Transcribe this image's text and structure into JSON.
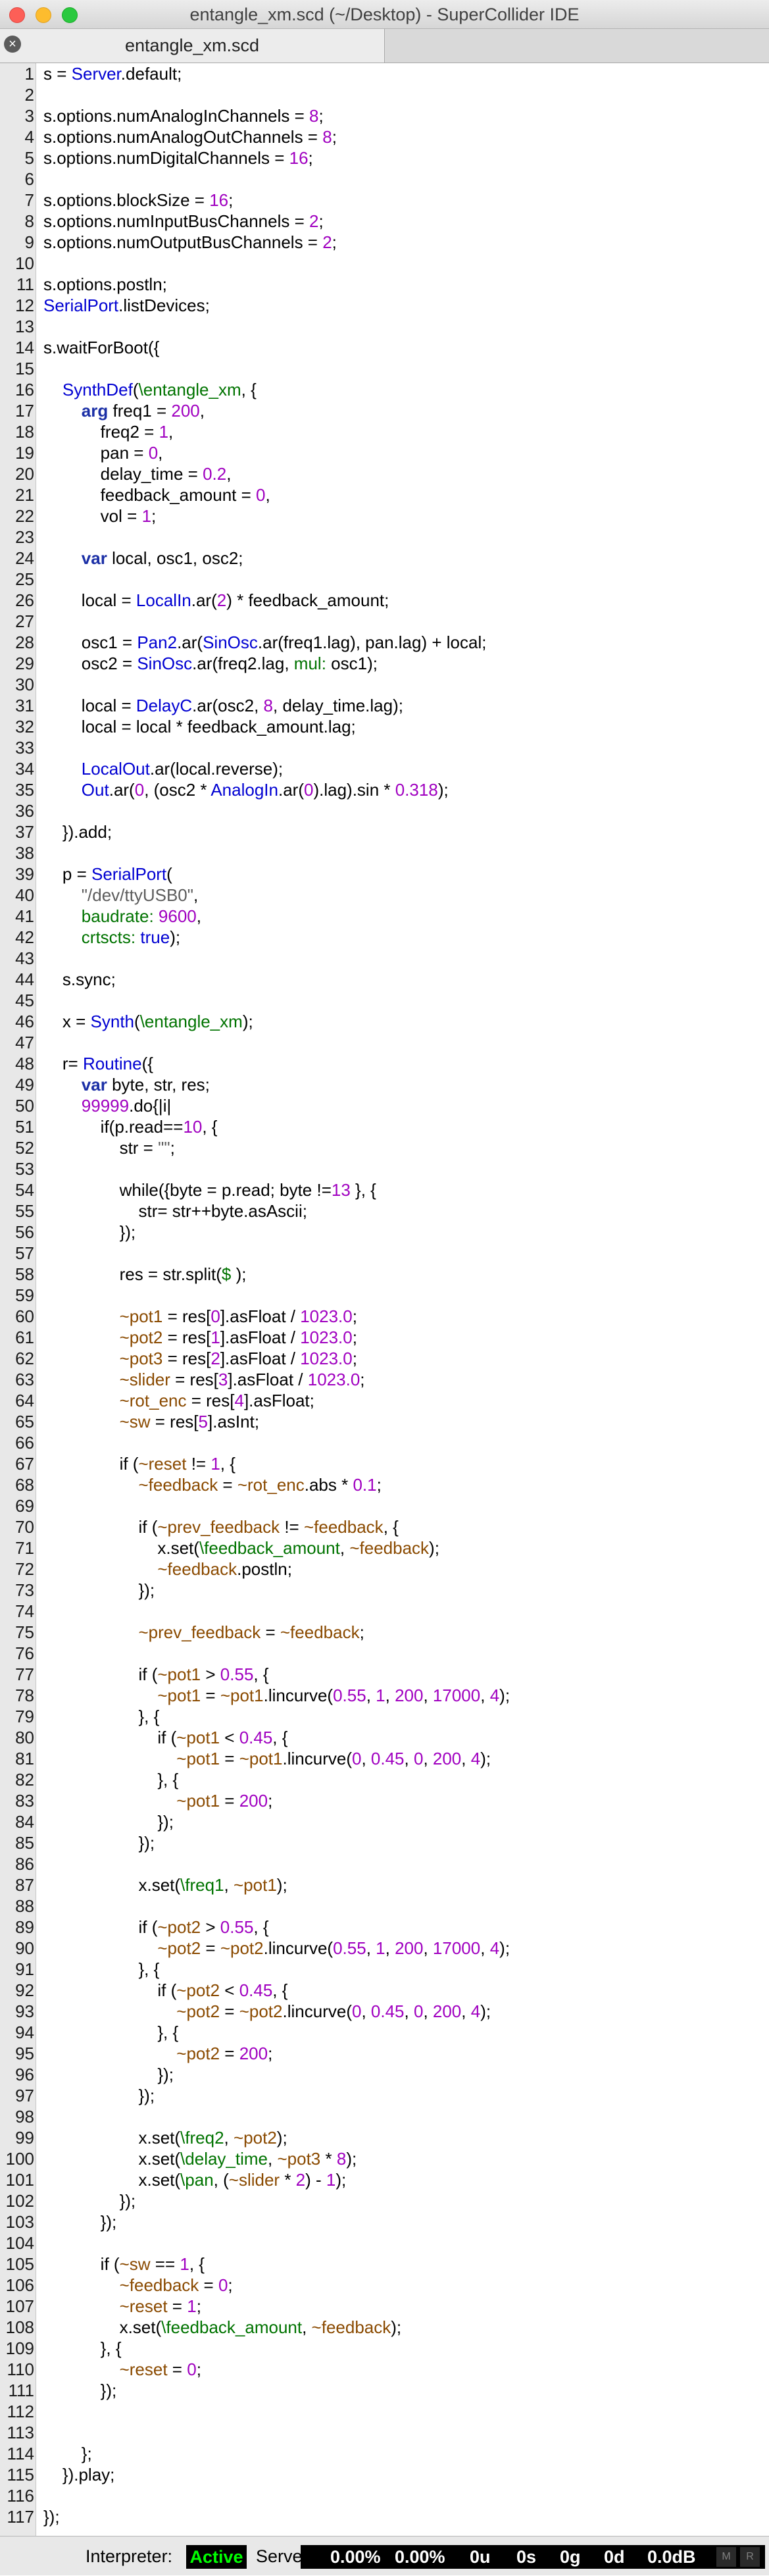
{
  "window": {
    "title": "entangle_xm.scd (~/Desktop) - SuperCollider IDE"
  },
  "tab": {
    "close_glyph": "×",
    "label": "entangle_xm.scd"
  },
  "editor": {
    "lines": [
      {
        "n": "1",
        "code": "s = [cls:Server].default;"
      },
      {
        "n": "2",
        "code": ""
      },
      {
        "n": "3",
        "code": "s.options.numAnalogInChannels = [num:8];"
      },
      {
        "n": "4",
        "code": "s.options.numAnalogOutChannels = [num:8];"
      },
      {
        "n": "5",
        "code": "s.options.numDigitalChannels = [num:16];"
      },
      {
        "n": "6",
        "code": ""
      },
      {
        "n": "7",
        "code": "s.options.blockSize = [num:16];"
      },
      {
        "n": "8",
        "code": "s.options.numInputBusChannels = [num:2];"
      },
      {
        "n": "9",
        "code": "s.options.numOutputBusChannels = [num:2];"
      },
      {
        "n": "10",
        "code": ""
      },
      {
        "n": "11",
        "code": "s.options.postln;"
      },
      {
        "n": "12",
        "code": "[cls:SerialPort].listDevices;"
      },
      {
        "n": "13",
        "code": ""
      },
      {
        "n": "14",
        "code": "s.waitForBoot({"
      },
      {
        "n": "15",
        "code": ""
      },
      {
        "n": "16",
        "code": "    [cls:SynthDef]([sym:\\entangle_xm], {"
      },
      {
        "n": "17",
        "code": "        [kw:arg] freq1 = [num:200],"
      },
      {
        "n": "18",
        "code": "            freq2 = [num:1],"
      },
      {
        "n": "19",
        "code": "            pan = [num:0],"
      },
      {
        "n": "20",
        "code": "            delay_time = [num:0.2],"
      },
      {
        "n": "21",
        "code": "            feedback_amount = [num:0],"
      },
      {
        "n": "22",
        "code": "            vol = [num:1];"
      },
      {
        "n": "23",
        "code": ""
      },
      {
        "n": "24",
        "code": "        [kw:var] local, osc1, osc2;"
      },
      {
        "n": "25",
        "code": ""
      },
      {
        "n": "26",
        "code": "        local = [cls:LocalIn].ar([num:2]) * feedback_amount;"
      },
      {
        "n": "27",
        "code": ""
      },
      {
        "n": "28",
        "code": "        osc1 = [cls:Pan2].ar([cls:SinOsc].ar(freq1.lag), pan.lag) + local;"
      },
      {
        "n": "29",
        "code": "        osc2 = [cls:SinOsc].ar(freq2.lag, [sym:mul:] osc1);"
      },
      {
        "n": "30",
        "code": ""
      },
      {
        "n": "31",
        "code": "        local = [cls:DelayC].ar(osc2, [num:8], delay_time.lag);"
      },
      {
        "n": "32",
        "code": "        local = local * feedback_amount.lag;"
      },
      {
        "n": "33",
        "code": ""
      },
      {
        "n": "34",
        "code": "        [cls:LocalOut].ar(local.reverse);"
      },
      {
        "n": "35",
        "code": "        [cls:Out].ar([num:0], (osc2 * [cls:AnalogIn].ar([num:0]).lag).sin * [num:0.318]);"
      },
      {
        "n": "36",
        "code": ""
      },
      {
        "n": "37",
        "code": "    }).add;"
      },
      {
        "n": "38",
        "code": ""
      },
      {
        "n": "39",
        "code": "    p = [cls:SerialPort]("
      },
      {
        "n": "40",
        "code": "        [str:\"/dev/ttyUSB0\"],"
      },
      {
        "n": "41",
        "code": "        [sym:baudrate:] [num:9600],"
      },
      {
        "n": "42",
        "code": "        [sym:crtscts:] [cls:true]);"
      },
      {
        "n": "43",
        "code": ""
      },
      {
        "n": "44",
        "code": "    s.sync;"
      },
      {
        "n": "45",
        "code": ""
      },
      {
        "n": "46",
        "code": "    x = [cls:Synth]([sym:\\entangle_xm]);"
      },
      {
        "n": "47",
        "code": ""
      },
      {
        "n": "48",
        "code": "    r= [cls:Routine]({"
      },
      {
        "n": "49",
        "code": "        [kw:var] byte, str, res;"
      },
      {
        "n": "50",
        "code": "        [num:99999].do{|i|"
      },
      {
        "n": "51",
        "code": "            if(p.read==[num:10], {"
      },
      {
        "n": "52",
        "code": "                str = [str:\"\"];"
      },
      {
        "n": "53",
        "code": ""
      },
      {
        "n": "54",
        "code": "                while({byte = p.read; byte !=[num:13] }, {"
      },
      {
        "n": "55",
        "code": "                    str= str++byte.asAscii;"
      },
      {
        "n": "56",
        "code": "                });"
      },
      {
        "n": "57",
        "code": ""
      },
      {
        "n": "58",
        "code": "                res = str.split([sym:$ ]);"
      },
      {
        "n": "59",
        "code": ""
      },
      {
        "n": "60",
        "code": "                [env:~pot1] = res[[num:0]].asFloat / [num:1023.0];"
      },
      {
        "n": "61",
        "code": "                [env:~pot2] = res[[num:1]].asFloat / [num:1023.0];"
      },
      {
        "n": "62",
        "code": "                [env:~pot3] = res[[num:2]].asFloat / [num:1023.0];"
      },
      {
        "n": "63",
        "code": "                [env:~slider] = res[[num:3]].asFloat / [num:1023.0];"
      },
      {
        "n": "64",
        "code": "                [env:~rot_enc] = res[[num:4]].asFloat;"
      },
      {
        "n": "65",
        "code": "                [env:~sw] = res[[num:5]].asInt;"
      },
      {
        "n": "66",
        "code": ""
      },
      {
        "n": "67",
        "code": "                if ([env:~reset] != [num:1], {"
      },
      {
        "n": "68",
        "code": "                    [env:~feedback] = [env:~rot_enc].abs * [num:0.1];"
      },
      {
        "n": "69",
        "code": ""
      },
      {
        "n": "70",
        "code": "                    if ([env:~prev_feedback] != [env:~feedback], {"
      },
      {
        "n": "71",
        "code": "                        x.set([sym:\\feedback_amount], [env:~feedback]);"
      },
      {
        "n": "72",
        "code": "                        [env:~feedback].postln;"
      },
      {
        "n": "73",
        "code": "                    });"
      },
      {
        "n": "74",
        "code": ""
      },
      {
        "n": "75",
        "code": "                    [env:~prev_feedback] = [env:~feedback];"
      },
      {
        "n": "76",
        "code": ""
      },
      {
        "n": "77",
        "code": "                    if ([env:~pot1] > [num:0.55], {"
      },
      {
        "n": "78",
        "code": "                        [env:~pot1] = [env:~pot1].lincurve([num:0.55], [num:1], [num:200], [num:17000], [num:4]);"
      },
      {
        "n": "79",
        "code": "                    }, {"
      },
      {
        "n": "80",
        "code": "                        if ([env:~pot1] < [num:0.45], {"
      },
      {
        "n": "81",
        "code": "                            [env:~pot1] = [env:~pot1].lincurve([num:0], [num:0.45], [num:0], [num:200], [num:4]);"
      },
      {
        "n": "82",
        "code": "                        }, {"
      },
      {
        "n": "83",
        "code": "                            [env:~pot1] = [num:200];"
      },
      {
        "n": "84",
        "code": "                        });"
      },
      {
        "n": "85",
        "code": "                    });"
      },
      {
        "n": "86",
        "code": ""
      },
      {
        "n": "87",
        "code": "                    x.set([sym:\\freq1], [env:~pot1]);"
      },
      {
        "n": "88",
        "code": ""
      },
      {
        "n": "89",
        "code": "                    if ([env:~pot2] > [num:0.55], {"
      },
      {
        "n": "90",
        "code": "                        [env:~pot2] = [env:~pot2].lincurve([num:0.55], [num:1], [num:200], [num:17000], [num:4]);"
      },
      {
        "n": "91",
        "code": "                    }, {"
      },
      {
        "n": "92",
        "code": "                        if ([env:~pot2] < [num:0.45], {"
      },
      {
        "n": "93",
        "code": "                            [env:~pot2] = [env:~pot2].lincurve([num:0], [num:0.45], [num:0], [num:200], [num:4]);"
      },
      {
        "n": "94",
        "code": "                        }, {"
      },
      {
        "n": "95",
        "code": "                            [env:~pot2] = [num:200];"
      },
      {
        "n": "96",
        "code": "                        });"
      },
      {
        "n": "97",
        "code": "                    });"
      },
      {
        "n": "98",
        "code": ""
      },
      {
        "n": "99",
        "code": "                    x.set([sym:\\freq2], [env:~pot2]);"
      },
      {
        "n": "100",
        "code": "                    x.set([sym:\\delay_time], [env:~pot3] * [num:8]);"
      },
      {
        "n": "101",
        "code": "                    x.set([sym:\\pan], ([env:~slider] * [num:2]) - [num:1]);"
      },
      {
        "n": "102",
        "code": "                });"
      },
      {
        "n": "103",
        "code": "            });"
      },
      {
        "n": "104",
        "code": ""
      },
      {
        "n": "105",
        "code": "            if ([env:~sw] == [num:1], {"
      },
      {
        "n": "106",
        "code": "                [env:~feedback] = [num:0];"
      },
      {
        "n": "107",
        "code": "                [env:~reset] = [num:1];"
      },
      {
        "n": "108",
        "code": "                x.set([sym:\\feedback_amount], [env:~feedback]);"
      },
      {
        "n": "109",
        "code": "            }, {"
      },
      {
        "n": "110",
        "code": "                [env:~reset] = [num:0];"
      },
      {
        "n": "111",
        "code": "            });"
      },
      {
        "n": "112",
        "code": ""
      },
      {
        "n": "113",
        "code": ""
      },
      {
        "n": "114",
        "code": "        };"
      },
      {
        "n": "115",
        "code": "    }).play;"
      },
      {
        "n": "116",
        "code": ""
      },
      {
        "n": "117",
        "code": "});"
      }
    ]
  },
  "status": {
    "interpreter_label": "Interpreter:",
    "interpreter_state": "Active",
    "server_label": "Server:",
    "avg_cpu": "0.00%",
    "peak_cpu": "0.00%",
    "ugens": "0u",
    "synths": "0s",
    "groups": "0g",
    "synthdefs": "0d",
    "volume": "0.0dB",
    "mute_button": "M",
    "record_button": "R"
  },
  "colors": {
    "class": "#0000d2",
    "keyword": "#1b2fa6",
    "symbol": "#007300",
    "number": "#a000c0",
    "env_var": "#8a4a00",
    "string": "#5c5c5c",
    "interpreter_active": "#00ff00"
  }
}
